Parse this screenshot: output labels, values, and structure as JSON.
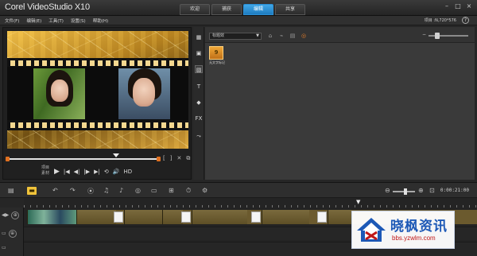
{
  "app": {
    "title": "Corel VideoStudio X10",
    "tabs": [
      {
        "label": "欢迎",
        "active": false
      },
      {
        "label": "捕获",
        "active": false
      },
      {
        "label": "编辑",
        "active": true
      },
      {
        "label": "共享",
        "active": false
      }
    ],
    "window_controls": [
      "–",
      "□",
      "×"
    ]
  },
  "menu": {
    "items": [
      "文件(F)",
      "编辑(E)",
      "工具(T)",
      "设置(S)",
      "帮助(H)"
    ],
    "project_info": "项目 :N,720*576",
    "help_icon": "?"
  },
  "player": {
    "mode_labels": [
      "项目",
      "素材"
    ],
    "transport_icons": [
      "play-icon",
      "home-icon",
      "prev-frame-icon",
      "next-frame-icon",
      "end-icon",
      "repeat-icon",
      "volume-icon",
      "hd-icon"
    ],
    "transport_glyphs": [
      "▶",
      "|◀",
      "◀|",
      "|▶",
      "▶|",
      "⟲",
      "🔊",
      "HD"
    ],
    "scrub_icon_glyphs": [
      "[",
      "]",
      "✕",
      "⧉"
    ],
    "progress_fraction": 0.72
  },
  "library": {
    "dropdown_value": "标题效",
    "tool_icons": [
      "add-folder-icon",
      "import-icon",
      "sort-icon",
      "browse-icon"
    ],
    "tool_glyphs": [
      "⌂",
      "⌁",
      "▤",
      "◎"
    ],
    "thumbnail": {
      "glyph": "9",
      "label": "无文字标记"
    },
    "size_slider_min": "−"
  },
  "side_toolbar": {
    "icons": [
      "media-icon",
      "instant-project-icon",
      "transition-icon",
      "title-icon",
      "graphics-icon",
      "filter-icon",
      "motion-path-icon"
    ],
    "glyphs": [
      "▦",
      "▣",
      "▧",
      "T",
      "◆",
      "FX",
      "⤳"
    ]
  },
  "timeline": {
    "toolbar_icons": [
      "storyboard-view-icon",
      "timeline-view-icon",
      "undo-icon",
      "redo-icon",
      "record-capture-icon",
      "sound-mixer-icon",
      "auto-music-icon",
      "motion-tracking-icon",
      "subtitle-editor-icon",
      "multi-camera-icon",
      "time-remapping-icon",
      "mask-creator-icon",
      "zoom-out-icon",
      "zoom-in-icon",
      "fit-project-icon"
    ],
    "toolbar_glyphs": [
      "▤",
      "▬",
      "↶",
      "↷",
      "⦿",
      "♫",
      "♪",
      "◎",
      "▭",
      "⊞",
      "⏱",
      "⚙",
      "⊖",
      "⊕",
      "⊡"
    ],
    "timecode": "0:00:21:00",
    "ruler_marker": "▼",
    "track_glyphs": [
      "▣",
      "⊕",
      "⊕"
    ],
    "track_head_glyphs": [
      "◀▶",
      "▭",
      "▭"
    ]
  },
  "watermark": {
    "name": "晓枫资讯",
    "url": "bbs.yzwlm.com"
  }
}
